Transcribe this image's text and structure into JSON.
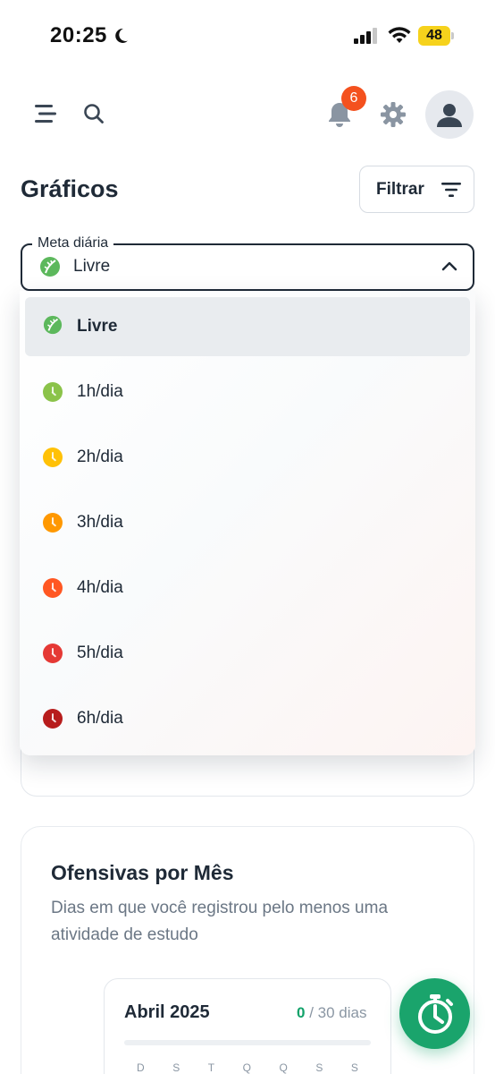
{
  "status_bar": {
    "time": "20:25",
    "battery": "48",
    "icons": [
      "moon-icon",
      "signal-icon",
      "wifi-icon",
      "battery-icon"
    ]
  },
  "header": {
    "notification_count": "6",
    "icons": [
      "menu-icon",
      "search-icon",
      "bell-icon",
      "gear-icon",
      "user-icon"
    ]
  },
  "page": {
    "title": "Gráficos",
    "filter_label": "Filtrar"
  },
  "goal_select": {
    "legend": "Meta diária",
    "selected": "Livre",
    "options": [
      {
        "label": "Livre",
        "icon": "leaf-icon",
        "color": "#5cb85c"
      },
      {
        "label": "1h/dia",
        "icon": "clock-icon",
        "color": "#8bc34a"
      },
      {
        "label": "2h/dia",
        "icon": "clock-icon",
        "color": "#ffc107"
      },
      {
        "label": "3h/dia",
        "icon": "clock-icon",
        "color": "#ff9800"
      },
      {
        "label": "4h/dia",
        "icon": "clock-icon",
        "color": "#ff5722"
      },
      {
        "label": "5h/dia",
        "icon": "clock-icon",
        "color": "#e53935"
      },
      {
        "label": "6h/dia",
        "icon": "clock-icon",
        "color": "#b71c1c"
      }
    ]
  },
  "streaks": {
    "title": "Ofensivas por Mês",
    "description": "Dias em que você registrou pelo menos uma atividade de estudo",
    "month": "Abril 2025",
    "count": "0",
    "total": "/ 30 dias",
    "weekdays": [
      "D",
      "S",
      "T",
      "Q",
      "Q",
      "S",
      "S"
    ]
  },
  "fab": {
    "icon": "stopwatch-icon"
  },
  "colors": {
    "accent": "#1aa46c",
    "badge": "#f4511e",
    "text": "#1f2a37"
  }
}
